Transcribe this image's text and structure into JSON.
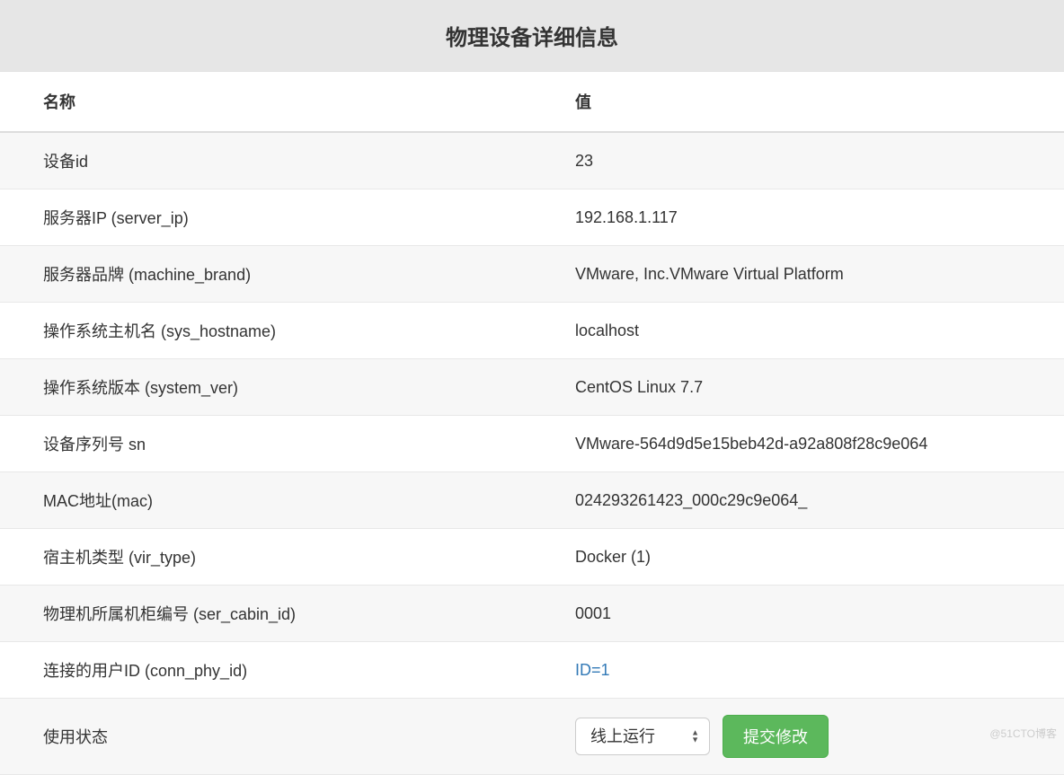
{
  "title": "物理设备详细信息",
  "table": {
    "headers": {
      "name": "名称",
      "value": "值"
    },
    "rows": [
      {
        "name": "设备id",
        "value": "23",
        "type": "text"
      },
      {
        "name": "服务器IP (server_ip)",
        "value": "192.168.1.117",
        "type": "text"
      },
      {
        "name": "服务器品牌 (machine_brand)",
        "value": "VMware, Inc.VMware Virtual Platform",
        "type": "text"
      },
      {
        "name": "操作系统主机名 (sys_hostname)",
        "value": "localhost",
        "type": "text"
      },
      {
        "name": "操作系统版本 (system_ver)",
        "value": "CentOS Linux 7.7",
        "type": "text"
      },
      {
        "name": "设备序列号 sn",
        "value": "VMware-564d9d5e15beb42d-a92a808f28c9e064",
        "type": "text"
      },
      {
        "name": "MAC地址(mac)",
        "value": "024293261423_000c29c9e064_",
        "type": "text"
      },
      {
        "name": "宿主机类型 (vir_type)",
        "value": "Docker (1)",
        "type": "text"
      },
      {
        "name": "物理机所属机柜编号 (ser_cabin_id)",
        "value": "0001",
        "type": "text"
      },
      {
        "name": "连接的用户ID (conn_phy_id)",
        "value": "ID=1",
        "type": "link"
      }
    ]
  },
  "status_row": {
    "label": "使用状态",
    "selected": "线上运行",
    "submit_label": "提交修改"
  },
  "watermark": "@51CTO博客"
}
